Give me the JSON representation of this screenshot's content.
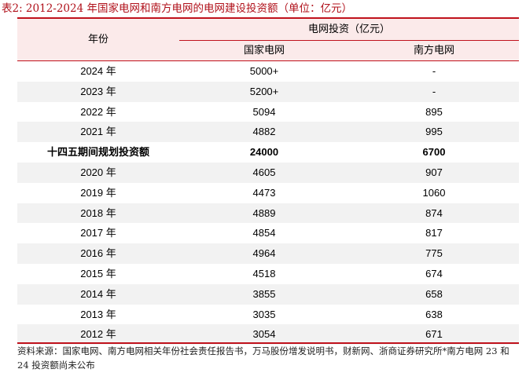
{
  "caption": "表2:   2012-2024 年国家电网和南方电网的电网建设投资额（单位：亿元）",
  "table": {
    "header_year": "年份",
    "header_group": "电网投资（亿元）",
    "columns": [
      "国家电网",
      "南方电网"
    ],
    "rows": [
      {
        "label": "2024 年",
        "state_grid": "5000+",
        "southern_grid": "-",
        "bold": false
      },
      {
        "label": "2023 年",
        "state_grid": "5200+",
        "southern_grid": "-",
        "bold": false
      },
      {
        "label": "2022 年",
        "state_grid": "5094",
        "southern_grid": "895",
        "bold": false
      },
      {
        "label": "2021 年",
        "state_grid": "4882",
        "southern_grid": "995",
        "bold": false
      },
      {
        "label": "十四五期间规划投资额",
        "state_grid": "24000",
        "southern_grid": "6700",
        "bold": true
      },
      {
        "label": "2020 年",
        "state_grid": "4605",
        "southern_grid": "907",
        "bold": false
      },
      {
        "label": "2019 年",
        "state_grid": "4473",
        "southern_grid": "1060",
        "bold": false
      },
      {
        "label": "2018 年",
        "state_grid": "4889",
        "southern_grid": "874",
        "bold": false
      },
      {
        "label": "2017 年",
        "state_grid": "4854",
        "southern_grid": "817",
        "bold": false
      },
      {
        "label": "2016 年",
        "state_grid": "4964",
        "southern_grid": "775",
        "bold": false
      },
      {
        "label": "2015 年",
        "state_grid": "4518",
        "southern_grid": "674",
        "bold": false
      },
      {
        "label": "2014 年",
        "state_grid": "3855",
        "southern_grid": "658",
        "bold": false
      },
      {
        "label": "2013 年",
        "state_grid": "3035",
        "southern_grid": "638",
        "bold": false
      },
      {
        "label": "2012 年",
        "state_grid": "3054",
        "southern_grid": "671",
        "bold": false
      }
    ]
  },
  "source_note": "资料来源：国家电网、南方电网相关年份社会责任报告书，万马股份增发说明书，财新网、浙商证券研究所*南方电网 23 和 24 投资额尚未公布",
  "colors": {
    "accent": "#c0121c",
    "header_bg": "#fbeaea",
    "alt_row": "#f2f2f2"
  }
}
